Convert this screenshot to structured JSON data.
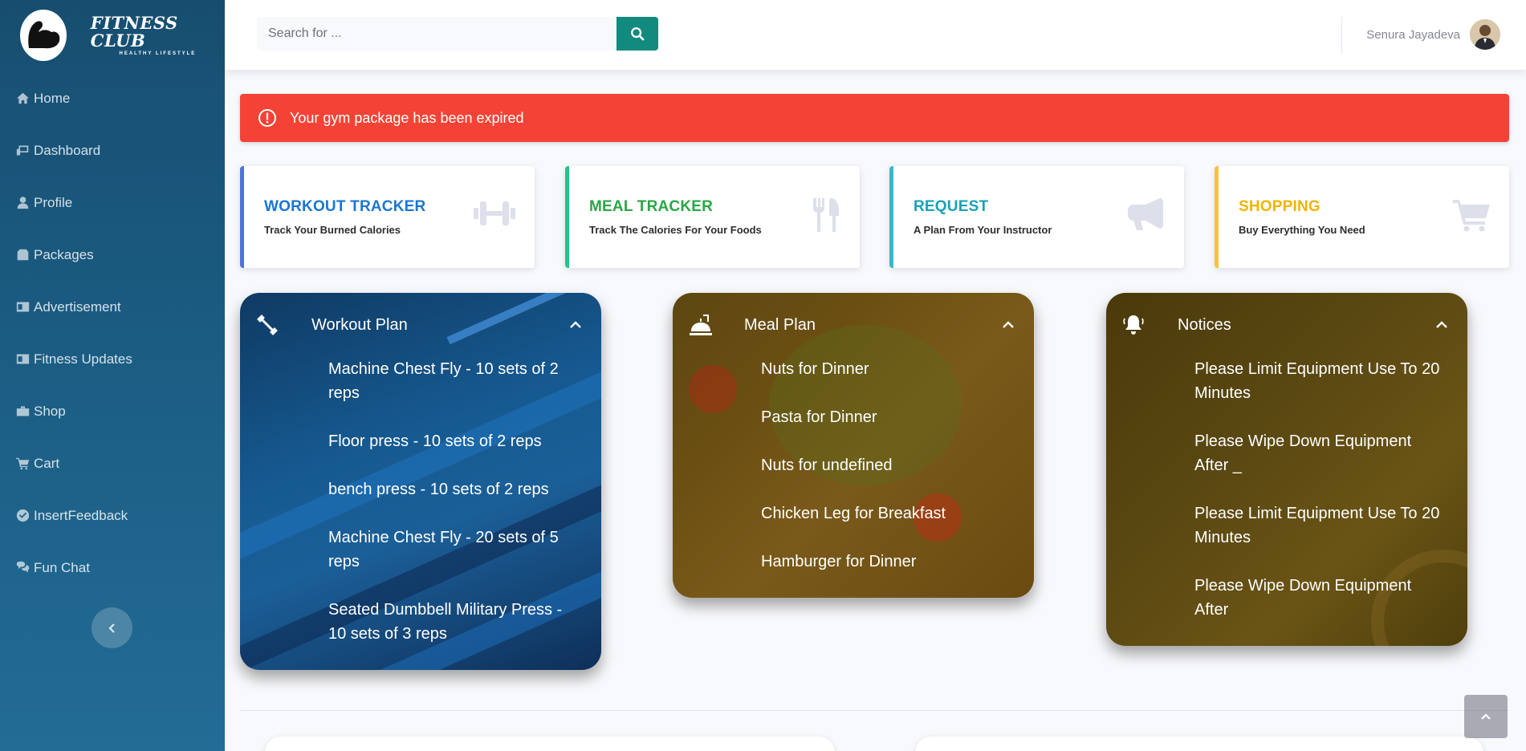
{
  "brand": {
    "name": "FITNESS CLUB",
    "tagline": "HEALTHY LIFESTYLE"
  },
  "sidebar": {
    "items": [
      {
        "label": "Home",
        "icon": "home-icon"
      },
      {
        "label": "Dashboard",
        "icon": "dashboard-icon"
      },
      {
        "label": "Profile",
        "icon": "user-icon"
      },
      {
        "label": "Packages",
        "icon": "box-icon"
      },
      {
        "label": "Advertisement",
        "icon": "ad-icon"
      },
      {
        "label": "Fitness Updates",
        "icon": "ad-icon"
      },
      {
        "label": "Shop",
        "icon": "briefcase-icon"
      },
      {
        "label": "Cart",
        "icon": "cart-icon"
      },
      {
        "label": "InsertFeedback",
        "icon": "check-circle-icon"
      },
      {
        "label": "Fun Chat",
        "icon": "comments-icon"
      }
    ]
  },
  "search": {
    "placeholder": "Search for ..."
  },
  "user": {
    "name": "Senura Jayadeva"
  },
  "alert": {
    "message": "Your gym package has been expired",
    "color": "#f44336"
  },
  "trackers": [
    {
      "title": "WORKOUT TRACKER",
      "subtitle": "Track Your Burned Calories",
      "color": "#4e73df",
      "icon": "dumbbell-icon"
    },
    {
      "title": "MEAL TRACKER",
      "subtitle": "Track The Calories For Your Foods",
      "color": "#1cc88a",
      "icon": "utensils-icon"
    },
    {
      "title": "REQUEST",
      "subtitle": "A Plan From Your Instructor",
      "color": "#36b9cc",
      "icon": "bullhorn-icon"
    },
    {
      "title": "SHOPPING",
      "subtitle": "Buy Everything You Need",
      "color": "#f6c23e",
      "icon": "shopping-cart-icon"
    }
  ],
  "workout_plan": {
    "title": "Workout Plan",
    "items": [
      "Machine Chest Fly - 10 sets of 2 reps",
      "Floor press - 10 sets of 2 reps",
      "bench press - 10 sets of 2 reps",
      "Machine Chest Fly - 20 sets of 5 reps",
      "Seated Dumbbell Military Press - 10 sets of 3 reps"
    ]
  },
  "meal_plan": {
    "title": "Meal Plan",
    "items": [
      "Nuts for Dinner",
      "Pasta for Dinner",
      "Nuts for undefined",
      "Chicken Leg for Breakfast",
      "Hamburger for Dinner"
    ]
  },
  "notices": {
    "title": "Notices",
    "items": [
      "Please Limit Equipment Use To 20 Minutes",
      "Please Wipe Down Equipment After _",
      "Please Limit Equipment Use To 20 Minutes",
      "Please Wipe Down Equipment After"
    ]
  }
}
